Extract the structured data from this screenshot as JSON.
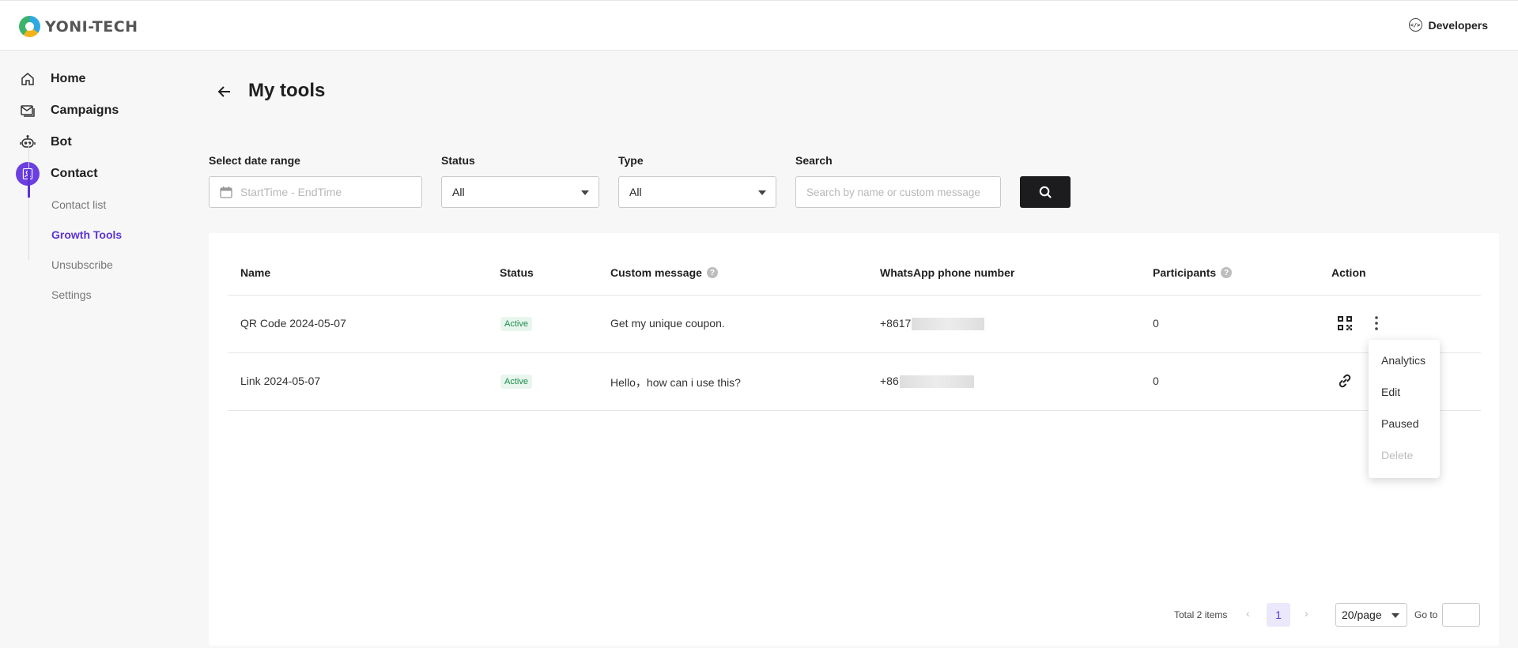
{
  "header": {
    "logo_text": "YONI-TECH",
    "developers_label": "Developers",
    "developers_icon": "code-icon"
  },
  "sidebar": {
    "items": [
      {
        "label": "Home",
        "icon": "home-icon"
      },
      {
        "label": "Campaigns",
        "icon": "campaigns-icon"
      },
      {
        "label": "Bot",
        "icon": "bot-icon"
      },
      {
        "label": "Contact",
        "icon": "contact-icon",
        "active": true
      }
    ],
    "sub_items": [
      {
        "label": "Contact list"
      },
      {
        "label": "Growth Tools",
        "active": true
      },
      {
        "label": "Unsubscribe"
      },
      {
        "label": "Settings"
      }
    ]
  },
  "page": {
    "title": "My tools"
  },
  "filters": {
    "date_label": "Select date range",
    "date_placeholder": "StartTime - EndTime",
    "status_label": "Status",
    "status_value": "All",
    "type_label": "Type",
    "type_value": "All",
    "search_label": "Search",
    "search_placeholder": "Search by name or custom message"
  },
  "table": {
    "columns": [
      "Name",
      "Status",
      "Custom message",
      "WhatsApp phone number",
      "Participants",
      "Action"
    ],
    "rows": [
      {
        "name": "QR Code 2024-05-07",
        "status": "Active",
        "message": "Get my unique coupon.",
        "phone": "+8617",
        "participants": "0",
        "action_icon": "qr-code-icon"
      },
      {
        "name": "Link 2024-05-07",
        "status": "Active",
        "message": "Hello，how can i use this?",
        "phone": "+86",
        "participants": "0",
        "action_icon": "link-icon"
      }
    ]
  },
  "menu": {
    "items": [
      "Analytics",
      "Edit",
      "Paused",
      "Delete"
    ]
  },
  "pagination": {
    "total": "Total 2 items",
    "current": "1",
    "page_size": "20/page",
    "goto_label": "Go to"
  },
  "colors": {
    "accent": "#5b33d6",
    "active_badge": "#1e8a4f"
  }
}
